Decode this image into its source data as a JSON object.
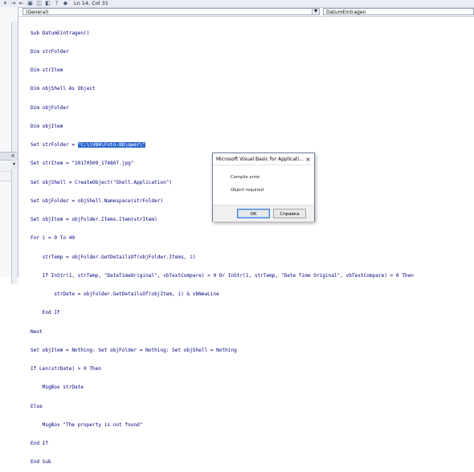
{
  "toolbar": {
    "cursor_position": "Ln 14, Col 31"
  },
  "code_window": {
    "object_dropdown": "(General)",
    "procedure_dropdown": "DatumEintragen",
    "lines": [
      "Sub DatumEintragen()",
      "Dim strFolder",
      "Dim strItem",
      "Dim objShell As Object",
      "Dim objFolder",
      "Dim objItem",
      "Set strFolder = ",
      "Set strItem = \"20170509_174807.jpg\"",
      "Set objShell = CreateObject(\"Shell.Application\")",
      "Set objFolder = objShell.Namespace(strFolder)",
      "Set objItem = objFolder.Items.Item(strItem)",
      "For i = 0 To 40",
      "    strTemp = objFolder.GetDetailsOf(objFolder.Items, i)",
      "    If InStr(1, strTemp, \"DateTimeOriginal\", vbTextCompare) > 0 Or InStr(1, strTemp, \"Date Time Original\", vbTextCompare) > 0 Then",
      "        strDate = objFolder.GetDetailsOf(objItem, i) & vbNewLine",
      "    End If",
      "Next",
      "Set objItem = Nothing: Set objFolder = Nothing: Set objShell = Nothing",
      "If Len(strDate) > 0 Then",
      "    MsgBox strDate",
      "Else",
      "    MsgBox \"The property is not found\"",
      "End If",
      "End Sub"
    ],
    "selected_text": "\"C:\\\\VBA\\Foto-BD\\qwer\\\""
  },
  "dialog": {
    "title": "Microsoft Visual Basic for Applicati...",
    "close_glyph": "×",
    "message_line1": "Compile error:",
    "message_line2": "Object required",
    "ok_label": "OK",
    "help_label": "Справка"
  },
  "icons": {
    "dropdown": "chevron-down-icon",
    "close": "close-icon"
  }
}
